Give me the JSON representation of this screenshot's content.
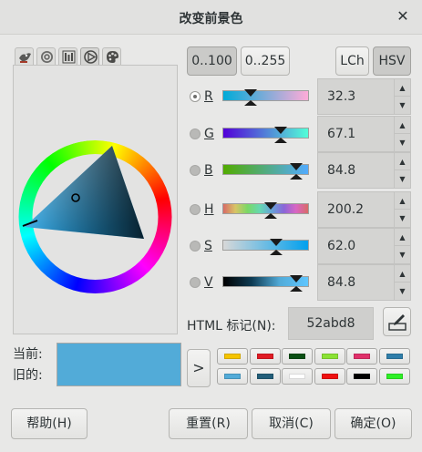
{
  "window": {
    "title": "改变前景色",
    "close_icon": "close-icon"
  },
  "selector_tabs": [
    {
      "icon": "gimp-wilber-icon",
      "active": false
    },
    {
      "icon": "cmyk-icon",
      "active": false
    },
    {
      "icon": "scales-icon",
      "active": false
    },
    {
      "icon": "triangle-wheel-icon",
      "active": true
    },
    {
      "icon": "palette-icon",
      "active": false
    }
  ],
  "range_buttons": {
    "r100": "0..100",
    "r255": "0..255"
  },
  "model_buttons": {
    "lch": "LCh",
    "hsv": "HSV"
  },
  "channels": [
    {
      "label": "R",
      "value": "32.3",
      "selected": true
    },
    {
      "label": "G",
      "value": "67.1",
      "selected": false
    },
    {
      "label": "B",
      "value": "84.8",
      "selected": false
    },
    {
      "label": "H",
      "value": "200.2",
      "selected": false
    },
    {
      "label": "S",
      "value": "62.0",
      "selected": false
    },
    {
      "label": "V",
      "value": "84.8",
      "selected": false
    }
  ],
  "html": {
    "label": "HTML 标记(N):",
    "value": "52abd8"
  },
  "current_label": "当前:",
  "old_label": "旧的:",
  "preview_color": "#52abd8",
  "history_arrow": ">",
  "history_colors": [
    [
      "#f5c400",
      "#e01b24",
      "#0a4f14",
      "#8ae234",
      "#e0306a",
      "#2f7eaa"
    ],
    [
      "#52abd8",
      "#235e7a",
      "#ffffff",
      "#ef1010",
      "#000000",
      "#2ef026"
    ]
  ],
  "buttons": {
    "help": "帮助(H)",
    "reset": "重置(R)",
    "cancel": "取消(C)",
    "ok": "确定(O)"
  }
}
